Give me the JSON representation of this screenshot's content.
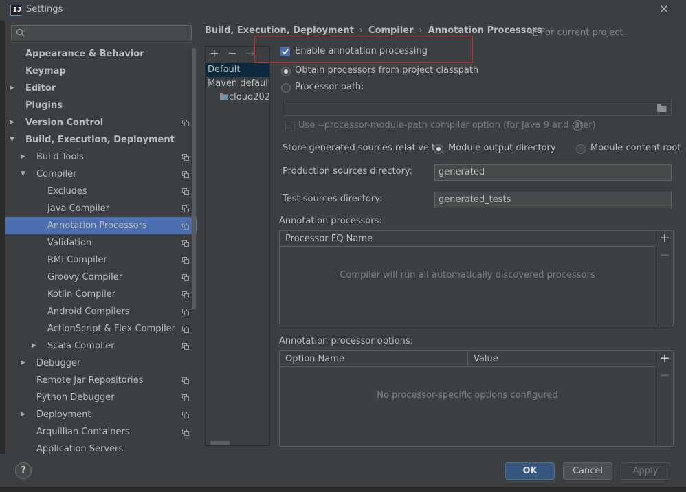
{
  "window": {
    "title": "Settings",
    "logo_text": "IJ",
    "colors": {
      "background": "#3c3f41",
      "selection": "#4b6eaf",
      "highlight": "#e02020",
      "primary_button": "#365880"
    }
  },
  "search": {
    "placeholder": ""
  },
  "tree": [
    {
      "label": "Appearance & Behavior",
      "bold": true
    },
    {
      "label": "Keymap",
      "bold": true
    },
    {
      "label": "Editor",
      "bold": true,
      "arrow": "right"
    },
    {
      "label": "Plugins",
      "bold": true
    },
    {
      "label": "Version Control",
      "bold": true,
      "arrow": "right",
      "copy": true
    },
    {
      "label": "Build, Execution, Deployment",
      "bold": true,
      "arrow": "down"
    },
    {
      "label": "Build Tools",
      "arrow": "right",
      "copy": true
    },
    {
      "label": "Compiler",
      "arrow": "down",
      "copy": true
    },
    {
      "label": "Excludes",
      "copy": true
    },
    {
      "label": "Java Compiler",
      "copy": true
    },
    {
      "label": "Annotation Processors",
      "copy": true,
      "selected": true
    },
    {
      "label": "Validation",
      "copy": true
    },
    {
      "label": "RMI Compiler",
      "copy": true
    },
    {
      "label": "Groovy Compiler",
      "copy": true
    },
    {
      "label": "Kotlin Compiler",
      "copy": true
    },
    {
      "label": "Android Compilers",
      "copy": true
    },
    {
      "label": "ActionScript & Flex Compiler",
      "copy": true
    },
    {
      "label": "Scala Compiler",
      "arrow": "right",
      "copy": true
    },
    {
      "label": "Debugger",
      "arrow": "right"
    },
    {
      "label": "Remote Jar Repositories",
      "copy": true
    },
    {
      "label": "Python Debugger",
      "copy": true
    },
    {
      "label": "Deployment",
      "arrow": "right",
      "copy": true
    },
    {
      "label": "Arquillian Containers",
      "copy": true
    },
    {
      "label": "Application Servers"
    }
  ],
  "breadcrumb": [
    "Build, Execution, Deployment",
    "Compiler",
    "Annotation Processors"
  ],
  "scope_note": "For current project",
  "profiles": {
    "toolbar": {
      "add": "+",
      "remove": "−",
      "move": "→"
    },
    "items": [
      "Default",
      "Maven default a",
      "cloud202"
    ]
  },
  "options": {
    "enable_processing": "Enable annotation processing",
    "obtain_classpath": "Obtain processors from project classpath",
    "processor_path": "Processor path:",
    "processor_path_value": "",
    "module_path_option": "Use --processor-module-path compiler option (for Java 9 and later)",
    "store_label": "Store generated sources relative to:",
    "module_output": "Module output directory",
    "module_content": "Module content root",
    "prod_label": "Production sources directory:",
    "prod_value": "generated",
    "test_label": "Test sources directory:",
    "test_value": "generated_tests"
  },
  "processors_table": {
    "section": "Annotation processors:",
    "header": "Processor FQ Name",
    "empty": "Compiler will run all automatically discovered processors"
  },
  "options_table": {
    "section": "Annotation processor options:",
    "headers": [
      "Option Name",
      "Value"
    ],
    "empty": "No processor-specific options configured"
  },
  "side_buttons": {
    "add": "+",
    "remove": "−"
  },
  "buttons": {
    "help": "?",
    "ok": "OK",
    "cancel": "Cancel",
    "apply": "Apply"
  }
}
